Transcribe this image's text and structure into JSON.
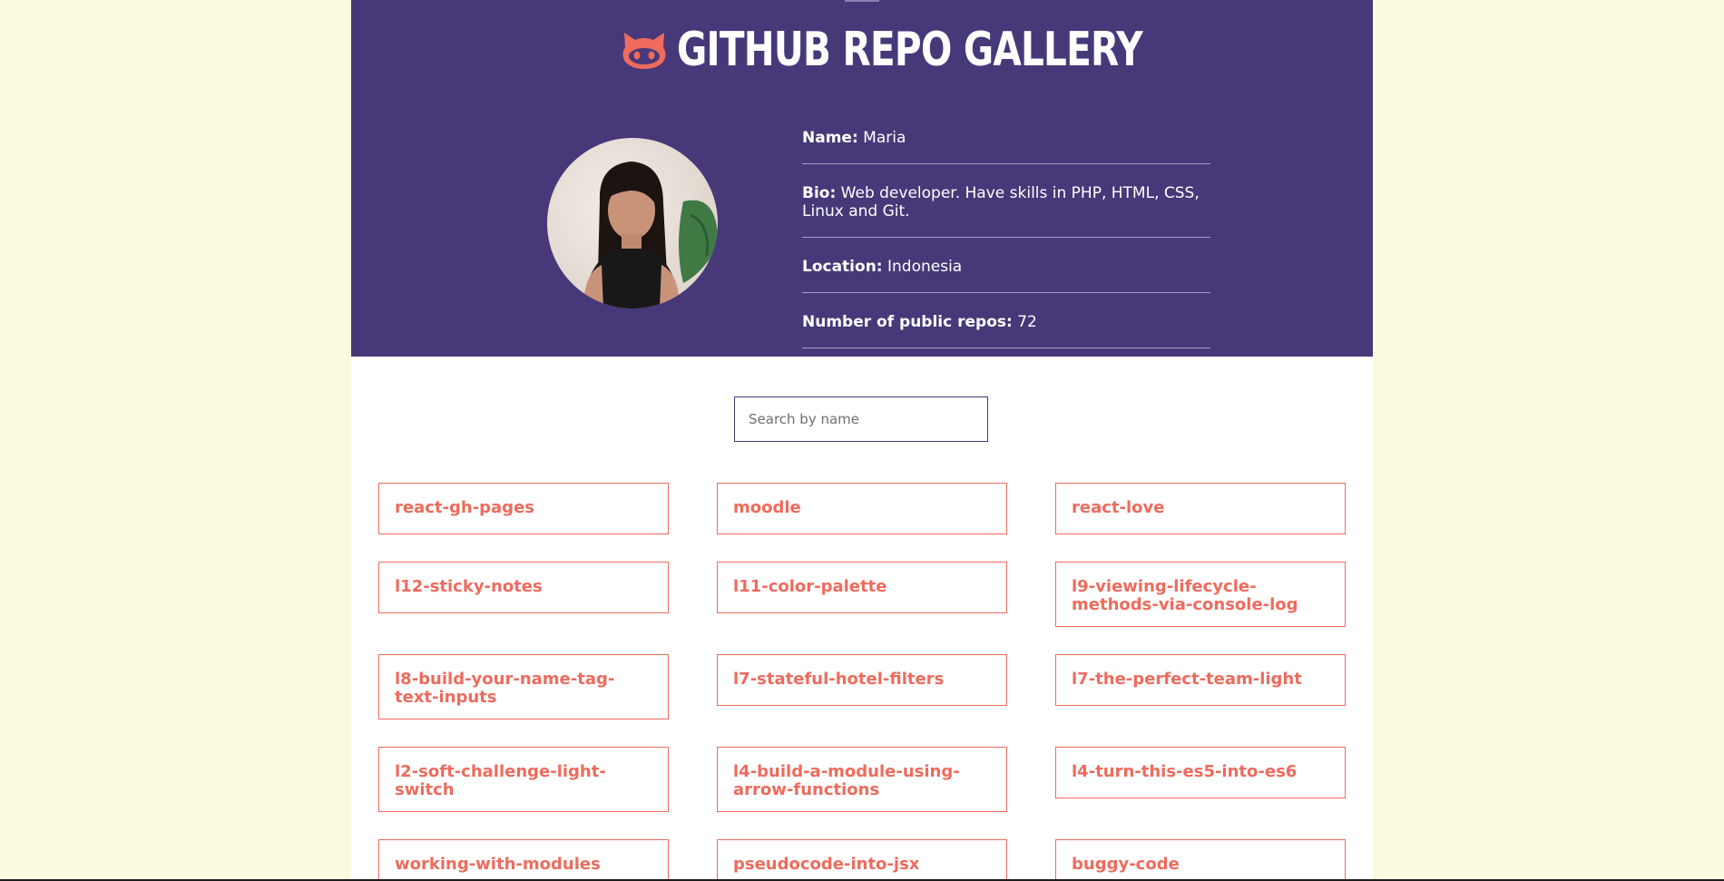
{
  "header": {
    "title": "GITHUB REPO GALLERY",
    "icon": "octocat-icon",
    "colors": {
      "background": "#473879",
      "accent": "#ee6b5d",
      "text": "#ffffff"
    }
  },
  "profile": {
    "name_label": "Name:",
    "name_value": "Maria",
    "bio_label": "Bio:",
    "bio_value": "Web developer. Have skills in PHP, HTML, CSS, Linux and Git.",
    "location_label": "Location:",
    "location_value": "Indonesia",
    "repos_label": "Number of public repos:",
    "repos_value": "72"
  },
  "search": {
    "placeholder": "Search by name",
    "value": ""
  },
  "repos": [
    "react-gh-pages",
    "moodle",
    "react-love",
    "l12-sticky-notes",
    "l11-color-palette",
    "l9-viewing-lifecycle-methods-via-console-log",
    "l8-build-your-name-tag-text-inputs",
    "l7-stateful-hotel-filters",
    "l7-the-perfect-team-light",
    "l2-soft-challenge-light-switch",
    "l4-build-a-module-using-arrow-functions",
    "l4-turn-this-es5-into-es6",
    "working-with-modules",
    "pseudocode-into-jsx",
    "buggy-code"
  ]
}
